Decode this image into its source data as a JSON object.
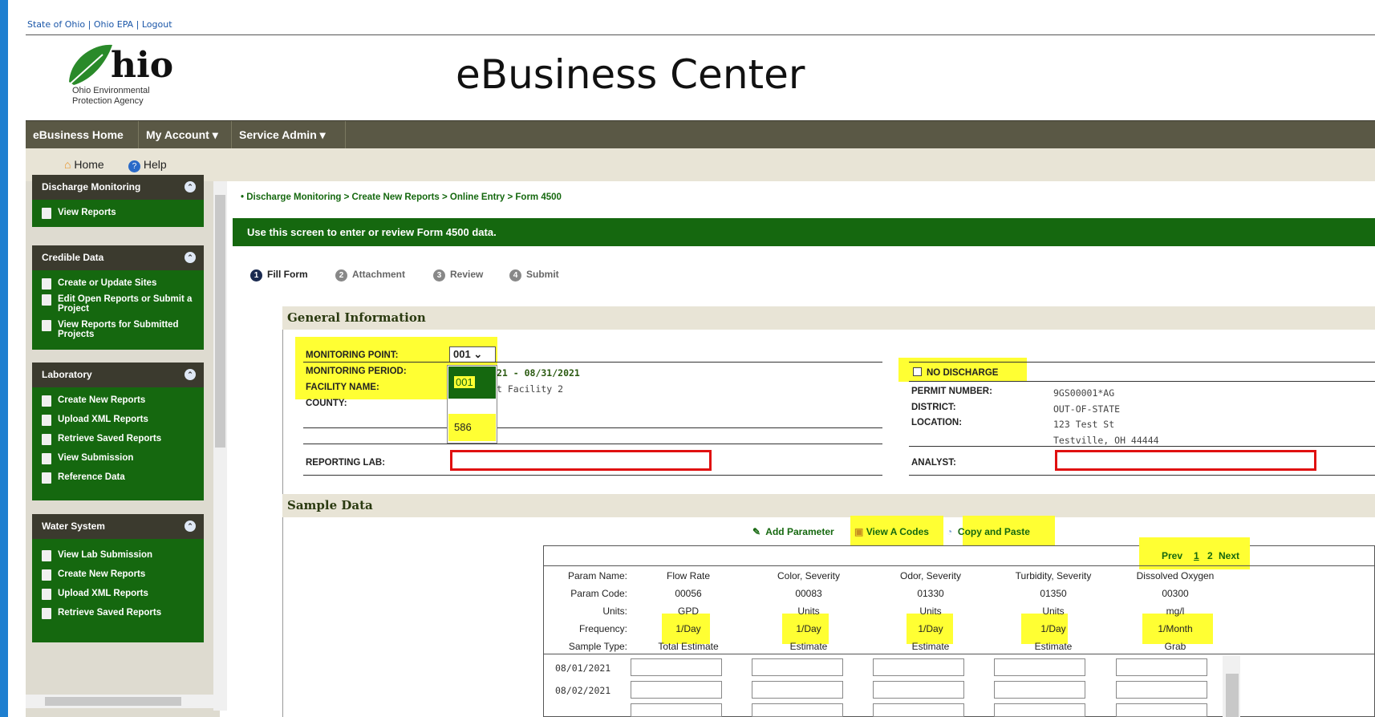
{
  "top_links": "State of Ohio | Ohio EPA | Logout",
  "logo": {
    "word": "hio",
    "line1": "Ohio Environmental",
    "line2": "Protection Agency"
  },
  "site_title": "eBusiness Center",
  "nav": {
    "home": "eBusiness Home",
    "account": "My Account",
    "admin": "Service Admin"
  },
  "subnav": {
    "home": "Home",
    "help": "Help"
  },
  "sidebar": {
    "discharge": {
      "title": "Discharge Monitoring",
      "items": [
        "View Reports"
      ]
    },
    "credible": {
      "title": "Credible Data",
      "items": [
        "Create or Update Sites",
        "Edit Open Reports or Submit a Project",
        "View Reports for Submitted Projects"
      ]
    },
    "laboratory": {
      "title": "Laboratory",
      "items": [
        "Create New Reports",
        "Upload XML Reports",
        "Retrieve Saved Reports",
        "View Submission",
        "Reference Data"
      ]
    },
    "water": {
      "title": "Water System",
      "items": [
        "View Lab Submission",
        "Create New Reports",
        "Upload XML Reports",
        "Retrieve Saved Reports"
      ]
    }
  },
  "breadcrumb": "Discharge Monitoring > Create New Reports > Online Entry > Form 4500",
  "info_banner": "Use this screen to enter or review Form 4500 data.",
  "steps": [
    {
      "num": "1",
      "label": "Fill Form"
    },
    {
      "num": "2",
      "label": "Attachment"
    },
    {
      "num": "3",
      "label": "Review"
    },
    {
      "num": "4",
      "label": "Submit"
    }
  ],
  "general": {
    "title": "General Information",
    "monitoring_point_label": "MONITORING POINT:",
    "monitoring_point_value": "001",
    "dropdown_options": [
      "001",
      "586"
    ],
    "monitoring_period_label": "MONITORING PERIOD:",
    "monitoring_period_value": "21 - 08/31/2021",
    "facility_label": "FACILITY NAME:",
    "facility_value": "t Facility 2",
    "county_label": "COUNTY:",
    "reporting_lab_label": "REPORTING LAB:",
    "no_discharge_label": "NO DISCHARGE",
    "permit_label": "PERMIT NUMBER:",
    "permit_value": "9GS00001*AG",
    "district_label": "DISTRICT:",
    "district_value": "OUT-OF-STATE",
    "location_label": "LOCATION:",
    "location_line1": "123 Test St",
    "location_line2": "Testville, OH 44444",
    "analyst_label": "ANALYST:"
  },
  "sample": {
    "title": "Sample Data",
    "add_parameter": "Add Parameter",
    "view_a_codes": "View A Codes",
    "copy_paste": "Copy and Paste",
    "pager": {
      "prev": "Prev",
      "page1": "1",
      "page2": "2",
      "next": "Next"
    },
    "row_labels": [
      "Param Name:",
      "Param Code:",
      "Units:",
      "Frequency:",
      "Sample Type:"
    ],
    "params": [
      {
        "name": "Flow Rate",
        "code": "00056",
        "units": "GPD",
        "frequency": "1/Day",
        "type": "Total Estimate"
      },
      {
        "name": "Color, Severity",
        "code": "00083",
        "units": "Units",
        "frequency": "1/Day",
        "type": "Estimate"
      },
      {
        "name": "Odor, Severity",
        "code": "01330",
        "units": "Units",
        "frequency": "1/Day",
        "type": "Estimate"
      },
      {
        "name": "Turbidity, Severity",
        "code": "01350",
        "units": "Units",
        "frequency": "1/Day",
        "type": "Estimate"
      },
      {
        "name": "Dissolved Oxygen",
        "code": "00300",
        "units": "mg/l",
        "frequency": "1/Month",
        "type": "Grab"
      }
    ],
    "dates": [
      "08/01/2021",
      "08/02/2021"
    ]
  }
}
